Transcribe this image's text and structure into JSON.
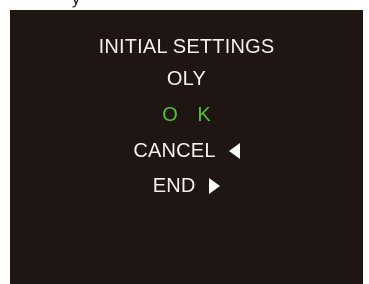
{
  "header": {
    "top_fragment": "y"
  },
  "screen": {
    "background": "#1f1512",
    "text_color": "#f2f2f2",
    "accent_color": "#53c232"
  },
  "menu": {
    "title": "INITIAL SETTINGS",
    "item_oly": "OLY",
    "item_ok": "O K",
    "item_cancel": "CANCEL",
    "item_end": "END",
    "cancel_icon": "left-triangle-icon",
    "end_icon": "right-triangle-icon"
  }
}
